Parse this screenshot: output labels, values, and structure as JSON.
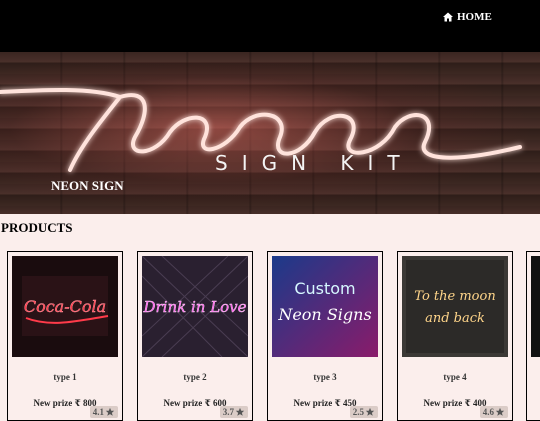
{
  "nav": {
    "home_label": "HOME",
    "home_icon": "home-icon"
  },
  "hero": {
    "neon_text": "Neon",
    "kit_text": "SIGN KIT",
    "label": "NEON SIGN"
  },
  "section": {
    "title": "PRODUCTS"
  },
  "products": [
    {
      "name": "type 1",
      "price": "New prize ₹ 800",
      "rating": "4.1",
      "sign_text": "Coca-Cola",
      "color": "#ff2a3a"
    },
    {
      "name": "type 2",
      "price": "New prize ₹ 600",
      "rating": "3.7",
      "sign_text": "Drink in Love",
      "color": "#ff3fe0"
    },
    {
      "name": "type 3",
      "price": "New prize ₹ 450",
      "rating": "2.5",
      "sign_text": "Custom Neon Signs",
      "color": "#bff5ff"
    },
    {
      "name": "type 4",
      "price": "New prize ₹ 400",
      "rating": "4.6",
      "sign_text": "To the moon and back",
      "color": "#ffd07a"
    }
  ]
}
